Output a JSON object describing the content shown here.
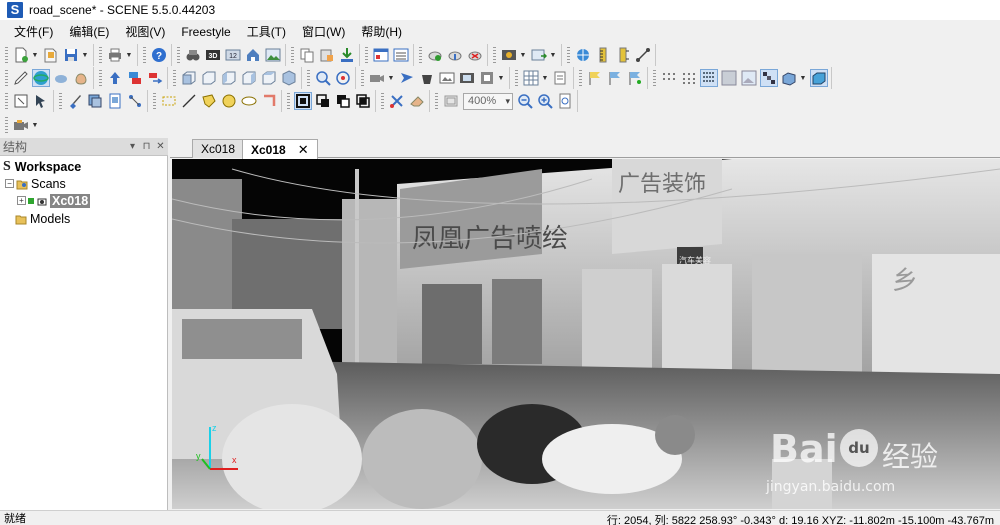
{
  "window": {
    "title": "road_scene* - SCENE 5.5.0.44203",
    "logo_letter": "S"
  },
  "menu": [
    "文件(F)",
    "编辑(E)",
    "视图(V)",
    "Freestyle",
    "工具(T)",
    "窗口(W)",
    "帮助(H)"
  ],
  "toolbar": {
    "zoom_value": "400%"
  },
  "structure_panel": {
    "title": "结构",
    "pin_glyph": "⊓",
    "close_glyph": "✕",
    "menu_glyph": "▾"
  },
  "tree": {
    "workspace_label": "Workspace",
    "scans_label": "Scans",
    "scan_item": "Xc018",
    "models_label": "Models",
    "expander_minus": "−",
    "expander_plus": "+"
  },
  "tabs": [
    {
      "label": "Xc018",
      "active": false
    },
    {
      "label": "Xc018",
      "active": true,
      "close": "✕"
    }
  ],
  "scene_signs": {
    "sign_center": "凤凰广告喷绘",
    "sign_right": "广告装饰",
    "sign_small": "汽车美容",
    "sign_far_right": "乡"
  },
  "axis": {
    "x_label": "x",
    "y_label": "y",
    "z_label": "z"
  },
  "watermark": {
    "brand": "Bai",
    "paw": "du",
    "cn": "经验",
    "url": "jingyan.baidu.com"
  },
  "status": {
    "left": "就绪",
    "right": "行: 2054, 列: 5822 258.93° -0.343° d: 19.16 XYZ: -11.802m -15.100m -43.767m"
  },
  "colors": {
    "accent": "#1e5bb5",
    "selection": "#858585"
  }
}
